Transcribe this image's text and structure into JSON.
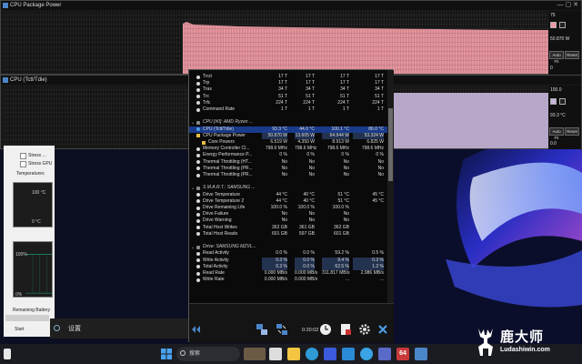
{
  "graph1": {
    "title": "CPU Package Power",
    "max_label": "75",
    "current_label": "50.870 W",
    "min_label": "0",
    "auto_fit": "Auto Fit",
    "reset": "Reset",
    "line_color": "#f19aa3"
  },
  "graph2": {
    "title": "CPU (Tctl/Tdie)",
    "max_label": "100.0",
    "current_label": "93.3 °C",
    "min_label": "0.0",
    "auto_fit": "Auto Fit",
    "reset": "Reset",
    "line_color": "#c8b6dc"
  },
  "sensor_window": {
    "item1": "Stress ...",
    "item2": "Stress GPU",
    "temps_label": "Temperatures",
    "temp_top": "100 °C",
    "temp_bottom": "0 °C",
    "pct_top": "100%",
    "pct_bottom": "0%",
    "remaining_label": "Remaining Battery",
    "start_label": "Start",
    "graph_label": "Usage"
  },
  "hwinfo": {
    "rows": [
      {
        "type": "val",
        "name": "Trcd",
        "cur": "17 T",
        "min": "17 T",
        "max": "17 T",
        "avg": "17 T"
      },
      {
        "type": "val",
        "name": "Trp",
        "cur": "17 T",
        "min": "17 T",
        "max": "17 T",
        "avg": "17 T"
      },
      {
        "type": "val",
        "name": "Tras",
        "cur": "34 T",
        "min": "34 T",
        "max": "34 T",
        "avg": "34 T"
      },
      {
        "type": "val",
        "name": "Trc",
        "cur": "51 T",
        "min": "51 T",
        "max": "51 T",
        "avg": "51 T"
      },
      {
        "type": "val",
        "name": "Trfc",
        "cur": "224 T",
        "min": "224 T",
        "max": "224 T",
        "avg": "224 T"
      },
      {
        "type": "val",
        "name": "Command Rate",
        "cur": "1 T",
        "min": "1 T",
        "max": "1 T",
        "avg": "1 T"
      },
      {
        "type": "blank"
      },
      {
        "type": "grp",
        "name": "CPU [#0]: AMD Ryzen ..."
      },
      {
        "type": "val",
        "name": "CPU (Tctl/Tdie)",
        "cur": "93.3 °C",
        "min": "44.0 °C",
        "max": "100.1 °C",
        "avg": "86.0 °C",
        "sel": true
      },
      {
        "type": "val",
        "name": "CPU Package Power",
        "cur": "50.870 W",
        "min": "13.605 W",
        "max": "64.944 W",
        "avg": "53.324 W",
        "hl": true
      },
      {
        "type": "val",
        "name": "Core Powers",
        "cur": "6.519 W",
        "min": "4.350 W",
        "max": "8.913 W",
        "avg": "6.825 W",
        "indent": true
      },
      {
        "type": "val",
        "name": "Memory Controller Cl...",
        "cur": "798.6 MHz",
        "min": "798.6 MHz",
        "max": "798.6 MHz",
        "avg": "798.6 MHz"
      },
      {
        "type": "val",
        "name": "Energy Performance P...",
        "cur": "0 %",
        "min": "0 %",
        "max": "0 %",
        "avg": "0 %"
      },
      {
        "type": "val",
        "name": "Thermal Throttling (HT...",
        "cur": "No",
        "min": "No",
        "max": "No",
        "avg": "No"
      },
      {
        "type": "val",
        "name": "Thermal Throttling (PR...",
        "cur": "No",
        "min": "No",
        "max": "No",
        "avg": "No"
      },
      {
        "type": "val",
        "name": "Thermal Throttling (PR...",
        "cur": "No",
        "min": "No",
        "max": "No",
        "avg": "No"
      },
      {
        "type": "blank"
      },
      {
        "type": "grp",
        "name": "S.M.A.R.T.: SAMSUNG ..."
      },
      {
        "type": "val",
        "name": "Drive Temperature",
        "cur": "44 °C",
        "min": "40 °C",
        "max": "51 °C",
        "avg": "45 °C"
      },
      {
        "type": "val",
        "name": "Drive Temperature 2",
        "cur": "44 °C",
        "min": "40 °C",
        "max": "51 °C",
        "avg": "45 °C"
      },
      {
        "type": "val",
        "name": "Drive Remaining Life",
        "cur": "100.0 %",
        "min": "100.0 %",
        "max": "100.0 %",
        "avg": ""
      },
      {
        "type": "val",
        "name": "Drive Failure",
        "cur": "No",
        "min": "No",
        "max": "No",
        "avg": ""
      },
      {
        "type": "val",
        "name": "Drive Warning",
        "cur": "No",
        "min": "No",
        "max": "No",
        "avg": ""
      },
      {
        "type": "val",
        "name": "Total Host Writes",
        "cur": "362 GB",
        "min": "361 GB",
        "max": "362 GB",
        "avg": ""
      },
      {
        "type": "val",
        "name": "Total Host Reads",
        "cur": "601 GB",
        "min": "597 GB",
        "max": "601 GB",
        "avg": ""
      },
      {
        "type": "blank"
      },
      {
        "type": "grp",
        "name": "Drive: SAMSUNG MZVL..."
      },
      {
        "type": "val",
        "name": "Read Activity",
        "cur": "0.0 %",
        "min": "0.0 %",
        "max": "59.2 %",
        "avg": "0.5 %"
      },
      {
        "type": "val",
        "name": "Write Activity",
        "cur": "0.3 %",
        "min": "0.0 %",
        "max": "9.4 %",
        "avg": "0.3 %",
        "hl": true
      },
      {
        "type": "val",
        "name": "Total Activity",
        "cur": "0.3 %",
        "min": "0.0 %",
        "max": "62.5 %",
        "avg": "1.2 %",
        "hl": true
      },
      {
        "type": "val",
        "name": "Read Rate",
        "cur": "0.000 MB/s",
        "min": "0.000 MB/s",
        "max": "311.817 MB/s",
        "avg": "2.986 MB/s"
      },
      {
        "type": "val",
        "name": "Write Rate",
        "cur": "0.000 MB/s",
        "min": "0.000 MB/s",
        "max": "...",
        "avg": "..."
      }
    ],
    "elapsed": "0:20:02"
  },
  "settings_bar": {
    "label": "设置"
  },
  "taskbar": {
    "search_placeholder": "搜索",
    "badge_count": "64"
  },
  "watermark": {
    "text": "鹿大师",
    "url": "Ludashiwin.com"
  },
  "colors": {
    "selected_row": "#1a3a8a",
    "hwinfo_bg": "#0a0a0a",
    "accent_blue": "#4a86c8"
  }
}
